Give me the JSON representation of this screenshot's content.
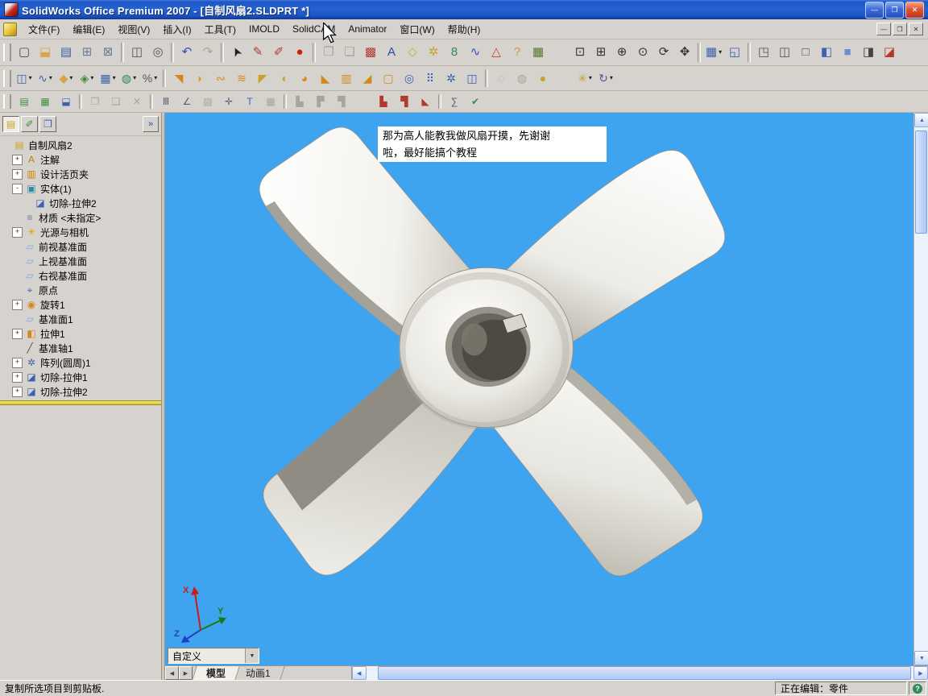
{
  "window": {
    "title": "SolidWorks Office Premium 2007 - [自制风扇2.SLDPRT *]",
    "controls": [
      {
        "id": "minimize",
        "glyph": "—"
      },
      {
        "id": "restore",
        "glyph": "❐"
      },
      {
        "id": "close",
        "glyph": "✕"
      }
    ],
    "mdi_controls": [
      {
        "id": "mdi-minimize",
        "glyph": "—"
      },
      {
        "id": "mdi-restore",
        "glyph": "❐"
      },
      {
        "id": "mdi-close",
        "glyph": "✕"
      }
    ]
  },
  "menu": {
    "items": [
      {
        "id": "file",
        "label": "文件(F)"
      },
      {
        "id": "edit",
        "label": "编辑(E)"
      },
      {
        "id": "view",
        "label": "视图(V)"
      },
      {
        "id": "insert",
        "label": "插入(I)"
      },
      {
        "id": "tools",
        "label": "工具(T)"
      },
      {
        "id": "imold",
        "label": "IMOLD"
      },
      {
        "id": "solidcam",
        "label": "SolidCAM"
      },
      {
        "id": "animator",
        "label": "Animator"
      },
      {
        "id": "window",
        "label": "窗口(W)"
      },
      {
        "id": "help",
        "label": "帮助(H)"
      }
    ]
  },
  "toolbars": [
    {
      "name": "toolbar-standard",
      "items": [
        {
          "n": "new-document",
          "g": "▢",
          "c": "#4A4A4A"
        },
        {
          "n": "open-document",
          "g": "⬓",
          "c": "#D9A441"
        },
        {
          "n": "save",
          "g": "▤",
          "c": "#3B5BA5"
        },
        {
          "n": "make-drawing-from-part",
          "g": "⊞",
          "c": "#6A7B9B"
        },
        {
          "n": "make-assembly-from-part",
          "g": "⊠",
          "c": "#6A7B9B"
        },
        {
          "t": "sep"
        },
        {
          "n": "print",
          "g": "◫",
          "c": "#555555"
        },
        {
          "n": "print-preview",
          "g": "◎",
          "c": "#555555"
        },
        {
          "t": "sep"
        },
        {
          "n": "undo",
          "g": "↶",
          "c": "#2A52BE"
        },
        {
          "n": "redo",
          "g": "↷",
          "c": "#999999",
          "disabled": true
        },
        {
          "t": "sep"
        },
        {
          "n": "select",
          "g": "➤",
          "c": "#222222",
          "rot": -115
        },
        {
          "n": "sketch",
          "g": "✎",
          "c": "#B03A2E"
        },
        {
          "n": "3d-sketch",
          "g": "✐",
          "c": "#B03A2E"
        },
        {
          "n": "rebuild",
          "g": "●",
          "c": "#CC2200"
        },
        {
          "t": "sep"
        },
        {
          "n": "copy",
          "g": "❐",
          "c": "#999999",
          "disabled": true
        },
        {
          "n": "paste",
          "g": "❏",
          "c": "#999999",
          "disabled": true
        },
        {
          "n": "edit-appearance",
          "g": "▩",
          "c": "#B03A2E"
        },
        {
          "n": "note-annotation",
          "g": "A",
          "c": "#1F4FA0"
        },
        {
          "n": "geometric-tolerance",
          "g": "◇",
          "c": "#D9A441"
        },
        {
          "n": "surface-finish",
          "g": "✲",
          "c": "#C9A227"
        },
        {
          "n": "solidcam-tools",
          "g": "8",
          "c": "#2E8B57"
        },
        {
          "n": "curvature",
          "g": "∿",
          "c": "#2A52BE"
        },
        {
          "n": "simulationxpress",
          "g": "△",
          "c": "#CC4422"
        },
        {
          "n": "help",
          "g": "?",
          "c": "#C9A227"
        },
        {
          "n": "options",
          "g": "▦",
          "c": "#55772A"
        },
        {
          "t": "gap"
        },
        {
          "n": "zoom-to-fit",
          "g": "⊡",
          "c": "#333333"
        },
        {
          "n": "zoom-to-area",
          "g": "⊞",
          "c": "#333333"
        },
        {
          "n": "zoom-in-out",
          "g": "⊕",
          "c": "#333333"
        },
        {
          "n": "zoom-to-selection",
          "g": "⊙",
          "c": "#333333"
        },
        {
          "n": "rotate-view",
          "g": "⟳",
          "c": "#333333"
        },
        {
          "n": "pan",
          "g": "✥",
          "c": "#333333"
        },
        {
          "t": "sep"
        },
        {
          "n": "standard-views",
          "g": "▦",
          "c": "#3A62B0",
          "dd": true
        },
        {
          "n": "view-orientation",
          "g": "◱",
          "c": "#3A62B0"
        },
        {
          "t": "sep"
        },
        {
          "n": "wireframe",
          "g": "◳",
          "c": "#555555"
        },
        {
          "n": "hidden-lines-visible",
          "g": "◫",
          "c": "#555555"
        },
        {
          "n": "hidden-lines-removed",
          "g": "□",
          "c": "#555555"
        },
        {
          "n": "shaded-with-edges",
          "g": "◧",
          "c": "#3A62B0"
        },
        {
          "n": "shaded",
          "g": "■",
          "c": "#6C8CD5"
        },
        {
          "n": "shadows-in-shaded-mode",
          "g": "◨",
          "c": "#444444"
        },
        {
          "n": "section-view",
          "g": "◪",
          "c": "#B03A2E"
        }
      ]
    },
    {
      "name": "toolbar-features",
      "items": [
        {
          "n": "reference-geometry",
          "g": "◫",
          "c": "#3A62B0",
          "dd": true
        },
        {
          "n": "curves",
          "g": "∿",
          "c": "#3A62B0",
          "dd": true
        },
        {
          "n": "sketch-dropdown",
          "g": "◆",
          "c": "#D9A441",
          "dd": true
        },
        {
          "n": "selection-filter",
          "g": "◈",
          "c": "#3F8F3F",
          "dd": true
        },
        {
          "n": "tools-dropdown",
          "g": "▦",
          "c": "#3A62B0",
          "dd": true
        },
        {
          "n": "mold-tools",
          "g": "◍",
          "c": "#2E8B57",
          "dd": true
        },
        {
          "n": "dimensions-relations",
          "g": "%",
          "c": "#555555",
          "dd": true
        },
        {
          "t": "sep"
        },
        {
          "n": "extruded-boss",
          "g": "◥",
          "c": "#D4881C"
        },
        {
          "n": "revolved-boss",
          "g": "◗",
          "c": "#C9A227"
        },
        {
          "n": "swept-boss",
          "g": "∾",
          "c": "#D4881C"
        },
        {
          "n": "lofted-boss",
          "g": "≋",
          "c": "#D4881C"
        },
        {
          "n": "extruded-cut",
          "g": "◤",
          "c": "#C9A227"
        },
        {
          "n": "revolved-cut",
          "g": "◖",
          "c": "#C9A227"
        },
        {
          "n": "fillet",
          "g": "◕",
          "c": "#D4881C"
        },
        {
          "n": "chamfer",
          "g": "◣",
          "c": "#D4881C"
        },
        {
          "n": "rib",
          "g": "▥",
          "c": "#D4881C"
        },
        {
          "n": "draft",
          "g": "◢",
          "c": "#D4881C"
        },
        {
          "n": "shell",
          "g": "▢",
          "c": "#D4881C"
        },
        {
          "n": "hole-wizard",
          "g": "◎",
          "c": "#3A62B0"
        },
        {
          "n": "linear-pattern",
          "g": "⠿",
          "c": "#3A62B0"
        },
        {
          "n": "circular-pattern",
          "g": "✲",
          "c": "#3A62B0"
        },
        {
          "n": "mirror-feature",
          "g": "◫",
          "c": "#3A62B0"
        },
        {
          "t": "sep"
        },
        {
          "n": "suppress",
          "g": "◌",
          "c": "#999999",
          "disabled": true
        },
        {
          "n": "unsuppress",
          "g": "◍",
          "c": "#999999",
          "disabled": true
        },
        {
          "n": "edit-color",
          "g": "●",
          "c": "#C9A227"
        },
        {
          "t": "gap"
        },
        {
          "n": "deform",
          "g": "✳",
          "c": "#C9A227",
          "dd": true
        },
        {
          "n": "flex",
          "g": "↻",
          "c": "#7A3FA5",
          "dd": true
        }
      ]
    },
    {
      "name": "toolbar-tables",
      "items": [
        {
          "n": "new-sheet",
          "g": "▤",
          "c": "#3F8F3F"
        },
        {
          "n": "add-sheet",
          "g": "▦",
          "c": "#3F8F3F"
        },
        {
          "n": "save-table",
          "g": "⬓",
          "c": "#3A62B0"
        },
        {
          "t": "sep"
        },
        {
          "n": "copy-table",
          "g": "❐",
          "c": "#999999",
          "disabled": true
        },
        {
          "n": "paste-table",
          "g": "❏",
          "c": "#999999",
          "disabled": true
        },
        {
          "n": "delete-table",
          "g": "✕",
          "c": "#999999",
          "disabled": true
        },
        {
          "t": "sep"
        },
        {
          "n": "insert-row",
          "g": "Ⅲ",
          "c": "#556070"
        },
        {
          "n": "angle-dimension",
          "g": "∠",
          "c": "#556070"
        },
        {
          "n": "area-hatch",
          "g": "▨",
          "c": "#999999",
          "disabled": true
        },
        {
          "n": "center-mark",
          "g": "✛",
          "c": "#556070"
        },
        {
          "n": "note-text",
          "g": "T",
          "c": "#3A62B0"
        },
        {
          "n": "table-grid",
          "g": "▦",
          "c": "#999999",
          "disabled": true
        },
        {
          "t": "sep"
        },
        {
          "n": "weld-symbol",
          "g": "▙",
          "c": "#999999",
          "disabled": true
        },
        {
          "n": "groove-weld",
          "g": "▛",
          "c": "#999999",
          "disabled": true
        },
        {
          "n": "fillet-weld",
          "g": "▜",
          "c": "#999999",
          "disabled": true
        },
        {
          "t": "gap"
        },
        {
          "n": "weldment",
          "g": "▙",
          "c": "#B03A2E"
        },
        {
          "n": "structural-member",
          "g": "▜",
          "c": "#B03A2E"
        },
        {
          "n": "gusset",
          "g": "◣",
          "c": "#B03A2E"
        },
        {
          "t": "sep"
        },
        {
          "n": "equations",
          "g": "∑",
          "c": "#556070"
        },
        {
          "n": "design-check",
          "g": "✔",
          "c": "#2E8B57"
        }
      ]
    }
  ],
  "panel": {
    "tabs": [
      {
        "id": "feature-manager",
        "glyph": "▤",
        "color": "#C9A227"
      },
      {
        "id": "property-manager",
        "glyph": "✐",
        "color": "#3F8F3F"
      },
      {
        "id": "configuration-manager",
        "glyph": "❒",
        "color": "#3A62B0"
      }
    ]
  },
  "tree": {
    "icon_map": {
      "part": {
        "g": "▤",
        "c": "#C9A227"
      },
      "annotations": {
        "g": "A",
        "c": "#B8860B"
      },
      "design_binder": {
        "g": "▥",
        "c": "#CC8400"
      },
      "solid_bodies": {
        "g": "▣",
        "c": "#2E8BA5"
      },
      "cut_extrude": {
        "g": "◪",
        "c": "#3A62B0"
      },
      "material": {
        "g": "≡",
        "c": "#6B7B8C"
      },
      "lights": {
        "g": "☀",
        "c": "#E0A800"
      },
      "plane": {
        "g": "▱",
        "c": "#7FA8D9"
      },
      "origin": {
        "g": "⌖",
        "c": "#3A62B0"
      },
      "revolve": {
        "g": "◉",
        "c": "#D4881C"
      },
      "extrude": {
        "g": "◧",
        "c": "#D4881C"
      },
      "axis": {
        "g": "╱",
        "c": "#555555"
      },
      "circular_pattern": {
        "g": "✲",
        "c": "#3A62B0"
      }
    },
    "items": [
      {
        "id": "root",
        "label": "自制风扇2",
        "icon": "part",
        "depth": 0,
        "expand": ""
      },
      {
        "id": "annotations",
        "label": "注解",
        "icon": "annotations",
        "depth": 1,
        "expand": "+"
      },
      {
        "id": "design-binder",
        "label": "设计活页夹",
        "icon": "design_binder",
        "depth": 1,
        "expand": "+"
      },
      {
        "id": "solid-bodies",
        "label": "实体(1)",
        "icon": "solid_bodies",
        "depth": 1,
        "expand": "-"
      },
      {
        "id": "cut-extrude2-body",
        "label": "切除-拉伸2",
        "icon": "cut_extrude",
        "depth": 2,
        "expand": ""
      },
      {
        "id": "material",
        "label": "材质 <未指定>",
        "icon": "material",
        "depth": 1,
        "expand": ""
      },
      {
        "id": "lights-cameras",
        "label": "光源与相机",
        "icon": "lights",
        "depth": 1,
        "expand": "+"
      },
      {
        "id": "front-plane",
        "label": "前视基准面",
        "icon": "plane",
        "depth": 1,
        "expand": ""
      },
      {
        "id": "top-plane",
        "label": "上视基准面",
        "icon": "plane",
        "depth": 1,
        "expand": ""
      },
      {
        "id": "right-plane",
        "label": "右视基准面",
        "icon": "plane",
        "depth": 1,
        "expand": ""
      },
      {
        "id": "origin",
        "label": "原点",
        "icon": "origin",
        "depth": 1,
        "expand": ""
      },
      {
        "id": "revolve1",
        "label": "旋转1",
        "icon": "revolve",
        "depth": 1,
        "expand": "+"
      },
      {
        "id": "plane1",
        "label": "基准面1",
        "icon": "plane",
        "depth": 1,
        "expand": ""
      },
      {
        "id": "extrude1",
        "label": "拉伸1",
        "icon": "extrude",
        "depth": 1,
        "expand": "+"
      },
      {
        "id": "axis1",
        "label": "基准轴1",
        "icon": "axis",
        "depth": 1,
        "expand": ""
      },
      {
        "id": "circular-pattern1",
        "label": "阵列(圆周)1",
        "icon": "circular_pattern",
        "depth": 1,
        "expand": "+"
      },
      {
        "id": "cut-extrude1",
        "label": "切除-拉伸1",
        "icon": "cut_extrude",
        "depth": 1,
        "expand": "+"
      },
      {
        "id": "cut-extrude2",
        "label": "切除-拉伸2",
        "icon": "cut_extrude",
        "depth": 1,
        "expand": "+"
      }
    ]
  },
  "viewport": {
    "note_line1": "那为高人能教我做风扇开摸，先谢谢",
    "note_line2": "啦，最好能搞个教程",
    "customize_label": "自定义",
    "triad": {
      "x": "X",
      "y": "Y",
      "z": "Z"
    }
  },
  "doc_tabs": {
    "items": [
      {
        "id": "model",
        "label": "模型",
        "active": true
      },
      {
        "id": "animation1",
        "label": "动画1",
        "active": false
      }
    ]
  },
  "icons": {
    "caret": "▾",
    "combo_caret": "▼",
    "chevron": "»",
    "scroll_up": "▲",
    "scroll_down": "▼",
    "scroll_left": "◀",
    "scroll_right": "▶",
    "tab_prev": "◀",
    "tab_next": "▶",
    "help": "?"
  },
  "statusbar": {
    "left": "复制所选项目到剪贴板.",
    "right": "正在编辑：零件"
  },
  "colors": {
    "viewport_bg": "#3FA4F0",
    "toolbar_bg": "#D6D3CE",
    "rollback": "#E8D24C",
    "note_bg": "#FFFFFF",
    "titlebar_blue": "#2463D2"
  }
}
